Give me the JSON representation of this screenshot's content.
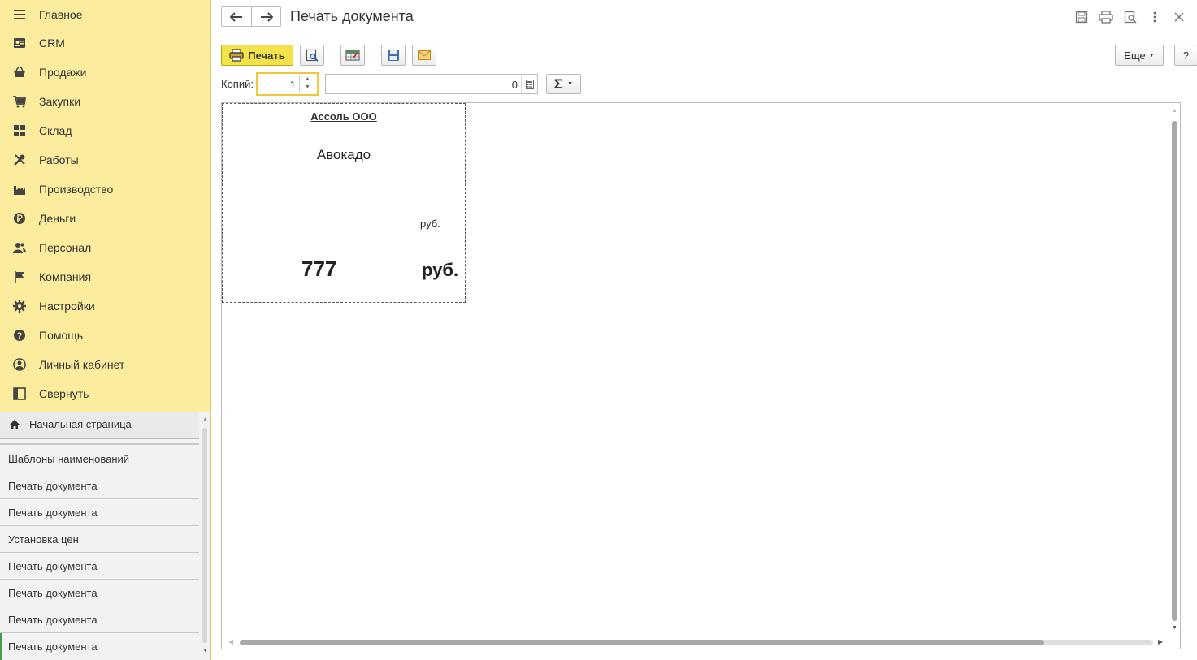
{
  "sidebar": {
    "sections": [
      {
        "label": "Главное",
        "icon": "menu-icon"
      },
      {
        "label": "CRM",
        "icon": "contact-card-icon"
      },
      {
        "label": "Продажи",
        "icon": "basket-icon"
      },
      {
        "label": "Закупки",
        "icon": "cart-icon"
      },
      {
        "label": "Склад",
        "icon": "warehouse-grid-icon"
      },
      {
        "label": "Работы",
        "icon": "tools-icon"
      },
      {
        "label": "Производство",
        "icon": "factory-icon"
      },
      {
        "label": "Деньги",
        "icon": "ruble-coin-icon"
      },
      {
        "label": "Персонал",
        "icon": "people-icon"
      },
      {
        "label": "Компания",
        "icon": "flag-icon"
      },
      {
        "label": "Настройки",
        "icon": "gear-icon"
      },
      {
        "label": "Помощь",
        "icon": "help-icon"
      },
      {
        "label": "Личный кабинет",
        "icon": "user-circle-icon"
      },
      {
        "label": "Свернуть",
        "icon": "collapse-panel-icon"
      }
    ],
    "history_home": "Начальная страница",
    "history": [
      "Шаблоны наименований",
      "Печать документа",
      "Печать документа",
      "Установка цен",
      "Печать документа",
      "Печать документа",
      "Печать документа",
      "Печать документа"
    ]
  },
  "header": {
    "title": "Печать документа"
  },
  "toolbar": {
    "print_label": "Печать",
    "more_label": "Еще",
    "help_label": "?"
  },
  "copies": {
    "label": "Копий:",
    "value": "1",
    "sum_value": "0"
  },
  "label_sheet": {
    "organization": "Ассоль ООО",
    "product": "Авокадо",
    "currency_small": "руб.",
    "price": "777",
    "currency_big": "руб."
  },
  "colors": {
    "sidebar_bg": "#fbec9e",
    "print_button": "#f4e24a",
    "active_history_marker": "#4a9a4a"
  }
}
